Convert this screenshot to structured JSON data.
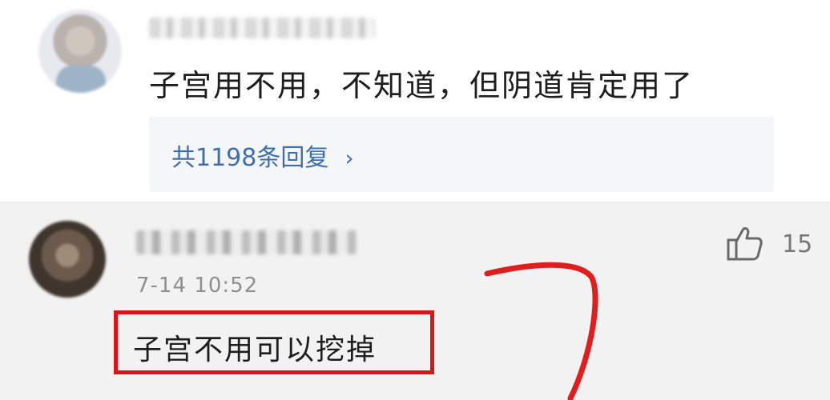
{
  "first_comment": {
    "text": "子宫用不用，不知道，但阴道肯定用了",
    "replies_label": "共1198条回复",
    "chevron": "›"
  },
  "second_comment": {
    "time": "7-14 10:52",
    "like_count": "15",
    "text": "子宫不用可以挖掉"
  },
  "icons": {
    "like": "thumbs-up-icon",
    "chevron": "chevron-right-icon"
  },
  "colors": {
    "link": "#3d6fb0",
    "highlight": "#d6161a"
  }
}
